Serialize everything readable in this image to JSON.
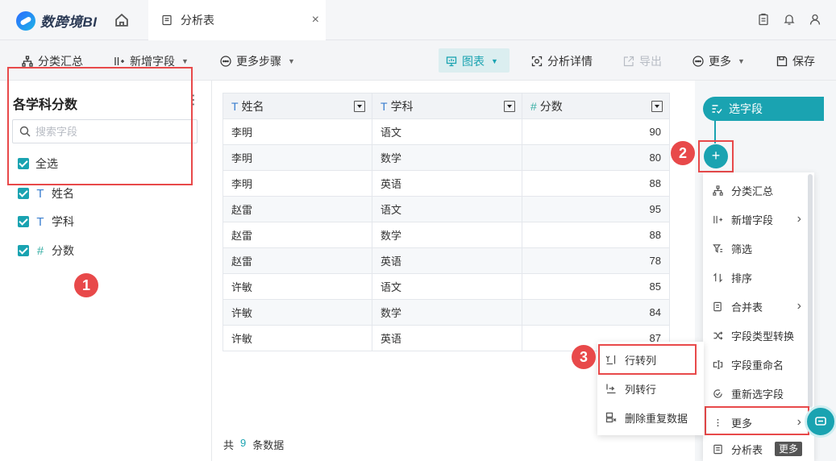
{
  "app": {
    "logo_text": "数跨境BI"
  },
  "tab": {
    "label": "分析表",
    "close": "×"
  },
  "toolbar": {
    "group_summary": "分类汇总",
    "add_field": "新增字段",
    "more_steps": "更多步骤",
    "chart": "图表",
    "analysis_detail": "分析详情",
    "export": "导出",
    "more": "更多",
    "save": "保存"
  },
  "left": {
    "title": "各学科分数",
    "search_placeholder": "搜索字段",
    "select_all": "全选",
    "fields": [
      {
        "type": "T",
        "name": "姓名"
      },
      {
        "type": "T",
        "name": "学科"
      },
      {
        "type": "#",
        "name": "分数"
      }
    ]
  },
  "badges": [
    "1",
    "2",
    "3"
  ],
  "table": {
    "columns": [
      {
        "type": "T",
        "name": "姓名"
      },
      {
        "type": "T",
        "name": "学科"
      },
      {
        "type": "#",
        "name": "分数"
      }
    ],
    "rows": [
      [
        "李明",
        "语文",
        "90"
      ],
      [
        "李明",
        "数学",
        "80"
      ],
      [
        "李明",
        "英语",
        "88"
      ],
      [
        "赵雷",
        "语文",
        "95"
      ],
      [
        "赵雷",
        "数学",
        "88"
      ],
      [
        "赵雷",
        "英语",
        "78"
      ],
      [
        "许敏",
        "语文",
        "85"
      ],
      [
        "许敏",
        "数学",
        "84"
      ],
      [
        "许敏",
        "英语",
        "87"
      ]
    ],
    "count_prefix": "共",
    "count": "9",
    "count_suffix": "条数据"
  },
  "flow": {
    "step": "选字段",
    "add": "+"
  },
  "menu": {
    "items": [
      {
        "label": "分类汇总",
        "icon": "tree-icon",
        "arrow": ""
      },
      {
        "label": "新增字段",
        "icon": "add-field-icon",
        "arrow": "›"
      },
      {
        "label": "筛选",
        "icon": "filter-icon",
        "arrow": ""
      },
      {
        "label": "排序",
        "icon": "sort-icon",
        "arrow": ""
      },
      {
        "label": "合并表",
        "icon": "merge-icon",
        "arrow": "›"
      },
      {
        "label": "字段类型转换",
        "icon": "shuffle-icon",
        "arrow": ""
      },
      {
        "label": "字段重命名",
        "icon": "rename-icon",
        "arrow": ""
      },
      {
        "label": "重新选字段",
        "icon": "reselect-icon",
        "arrow": ""
      },
      {
        "label": "更多",
        "icon": "dots-icon",
        "arrow": "›"
      },
      {
        "label": "分析表",
        "icon": "doc-icon",
        "arrow": ""
      }
    ]
  },
  "submenu": {
    "items": [
      {
        "label": "行转列",
        "icon": "row-to-col-icon"
      },
      {
        "label": "列转行",
        "icon": "col-to-row-icon"
      },
      {
        "label": "删除重复数据",
        "icon": "dedupe-icon"
      }
    ]
  },
  "tooltip": "更多"
}
